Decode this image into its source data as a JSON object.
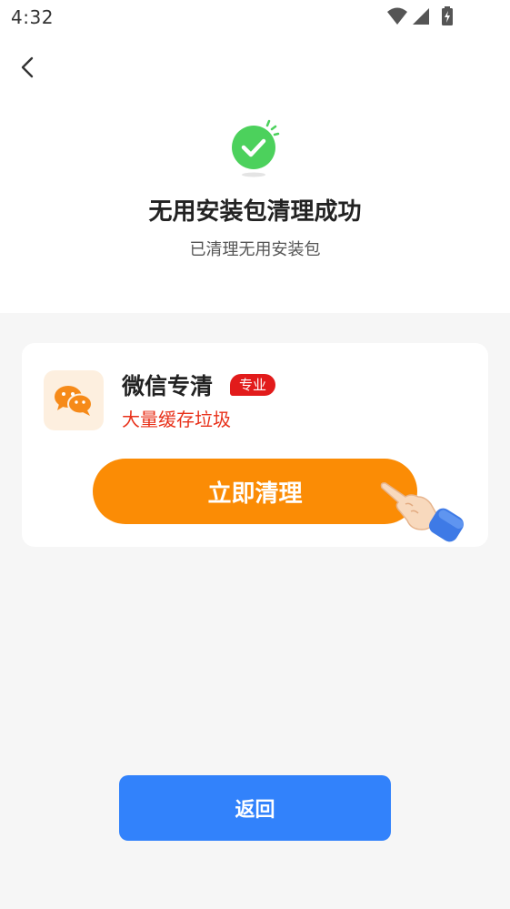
{
  "status_bar": {
    "time": "4:32",
    "icons": [
      "wifi-icon",
      "signal-icon",
      "battery-charging-icon"
    ]
  },
  "header": {
    "back_icon": "chevron-left-icon"
  },
  "result": {
    "icon": "success-check-icon",
    "accent_color": "#4cd15c",
    "title": "无用安装包清理成功",
    "subtitle": "已清理无用安装包"
  },
  "promo_card": {
    "app_icon": "wechat-icon",
    "app_name": "微信专清",
    "badge": "专业",
    "badge_color": "#e21b1b",
    "description": "大量缓存垃圾",
    "description_color": "#e8311a",
    "button_label": "立即清理",
    "button_color": "#fb8c05",
    "pointer_icon": "pointing-hand-icon"
  },
  "footer": {
    "return_label": "返回",
    "return_color": "#3282fb"
  }
}
